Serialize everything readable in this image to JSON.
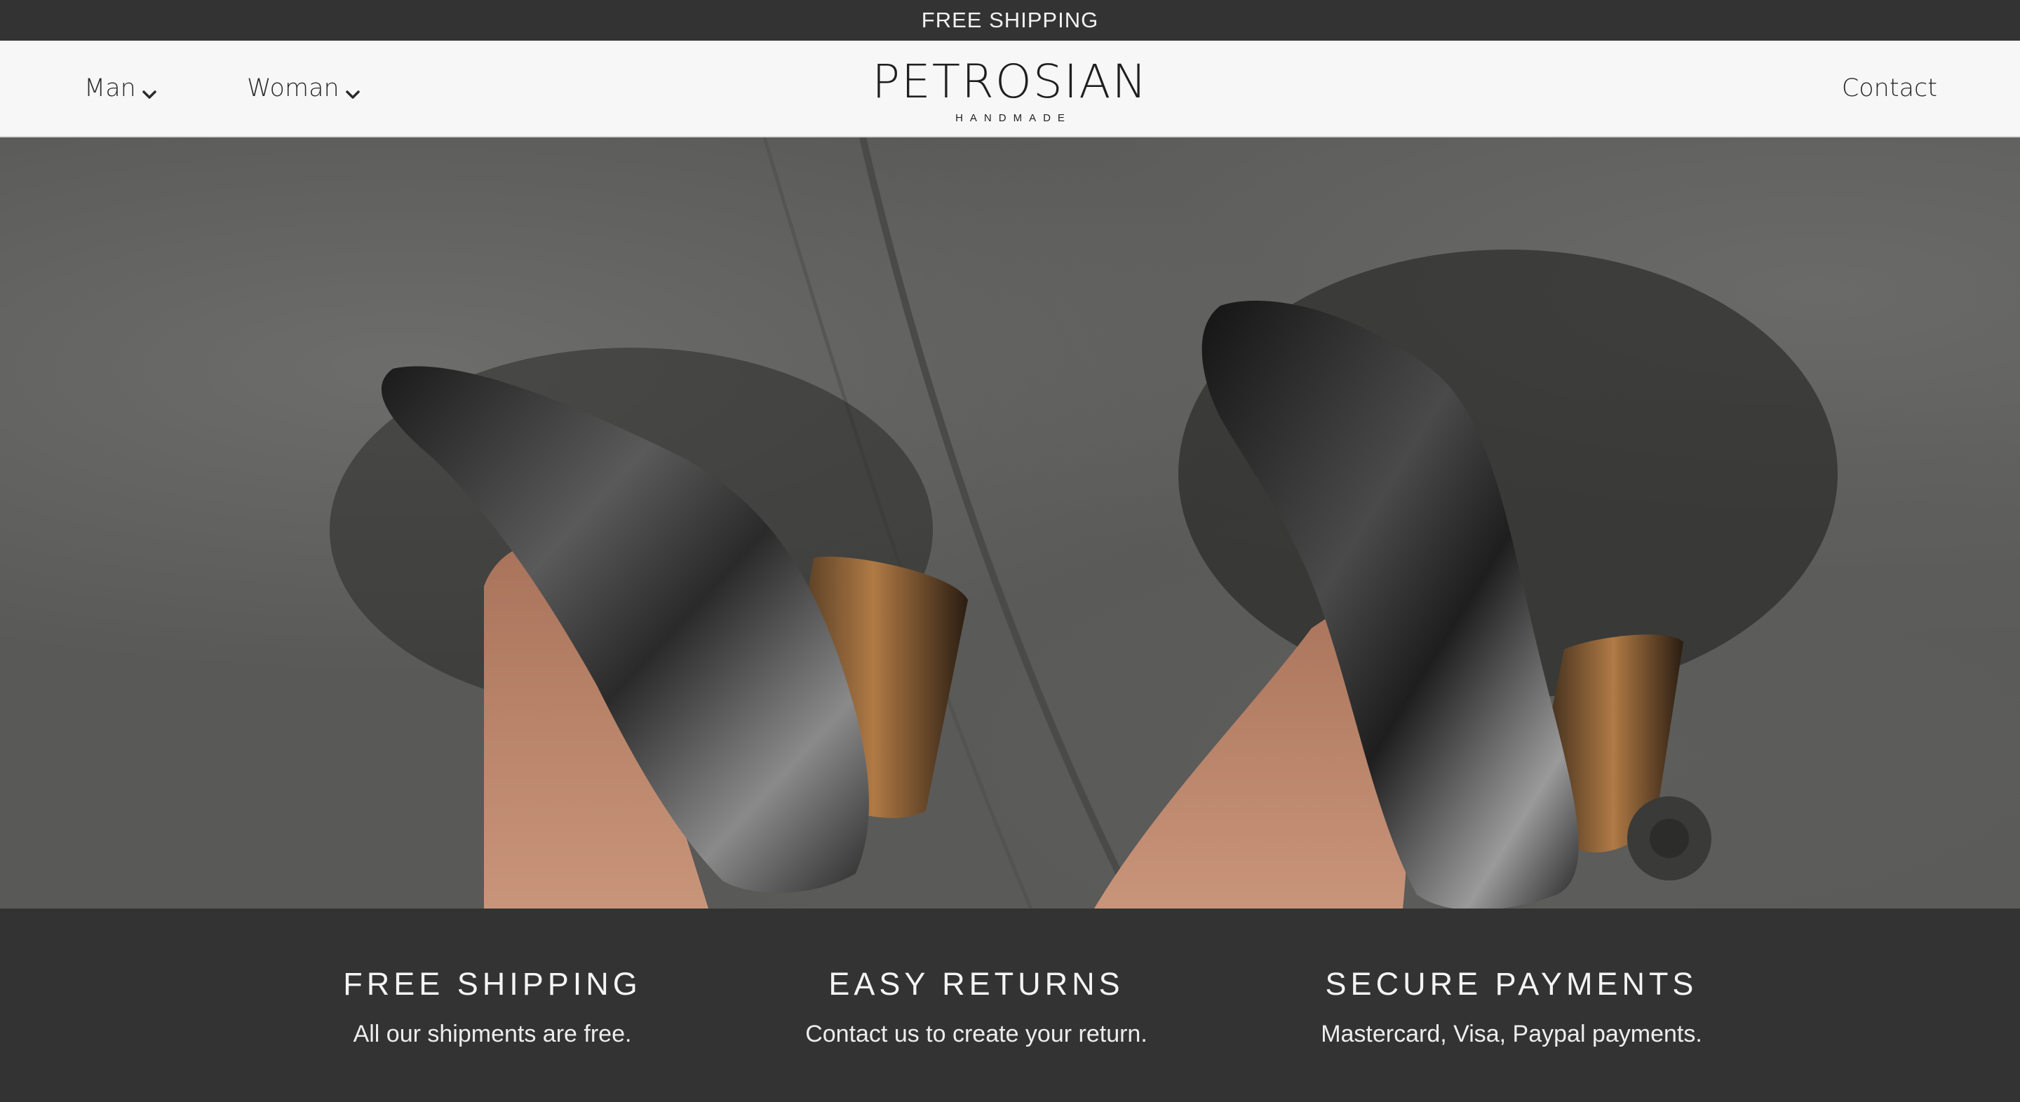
{
  "announcement": "FREE SHIPPING",
  "nav": {
    "man_label": "Man",
    "woman_label": "Woman",
    "contact_label": "Contact"
  },
  "logo": {
    "name": "PETROSIAN",
    "tagline": "HANDMADE"
  },
  "hero": {
    "image_alt": "Two feet wearing metallic pewter leather pumps with copper block heels on concrete"
  },
  "features": [
    {
      "title": "FREE SHIPPING",
      "description": "All our shipments are free."
    },
    {
      "title": "EASY RETURNS",
      "description": "Contact us to create your return."
    },
    {
      "title": "SECURE PAYMENTS",
      "description": "Mastercard, Visa, Paypal payments."
    }
  ],
  "colors": {
    "dark": "#333333",
    "header_bg": "#f7f7f7",
    "text_light": "#f4f4f4"
  },
  "icons": [
    "chevron-down-icon",
    "chevron-down-icon"
  ]
}
